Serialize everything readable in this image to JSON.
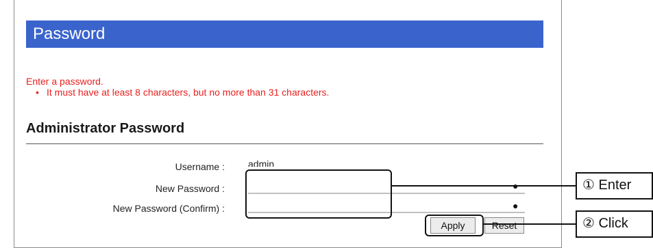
{
  "page": {
    "title": "Password"
  },
  "message": {
    "error": "Enter a password.",
    "bullet": "It must have at least 8 characters, but no more than 31 characters."
  },
  "section": {
    "title": "Administrator Password"
  },
  "form": {
    "username_label": "Username :",
    "username_value": "admin",
    "new_password_label": "New Password :",
    "confirm_password_label": "New Password (Confirm) :",
    "eye_icon": "eye-icon"
  },
  "buttons": {
    "apply": "Apply",
    "reset": "Reset"
  },
  "callouts": {
    "step1": "① Enter",
    "step2": "② Click"
  }
}
